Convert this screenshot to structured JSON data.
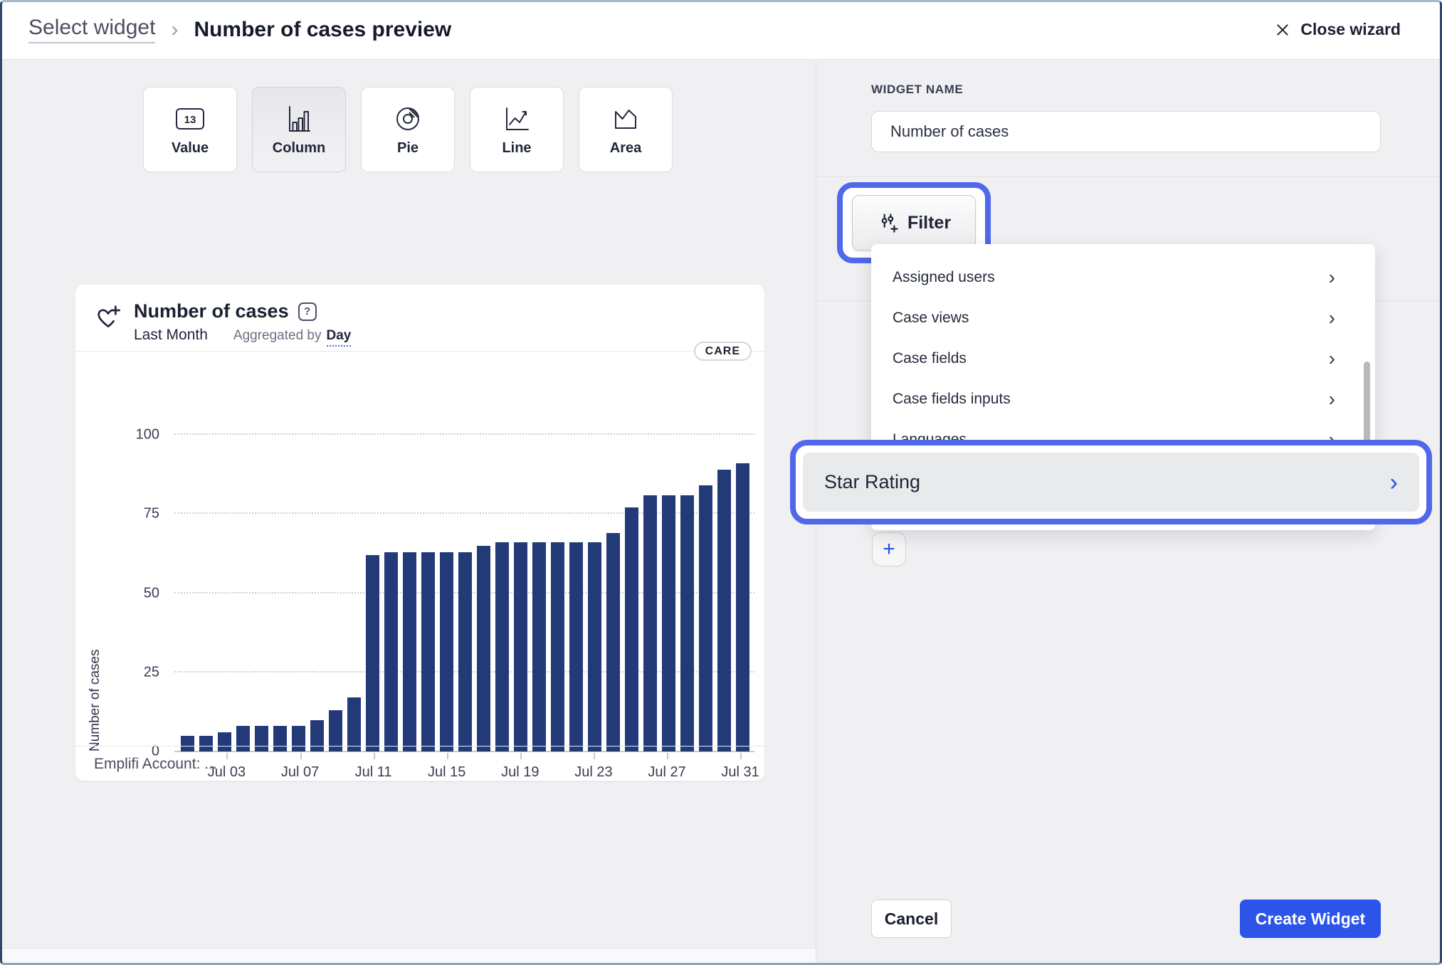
{
  "topbar": {
    "breadcrumb_back": "Select widget",
    "breadcrumb_separator": "›",
    "title": "Number of cases preview",
    "close_label": "Close wizard"
  },
  "widget_types": {
    "items": [
      {
        "label": "Value",
        "icon": "value-widget-icon",
        "selected": false
      },
      {
        "label": "Column",
        "icon": "column-widget-icon",
        "selected": true
      },
      {
        "label": "Pie",
        "icon": "pie-widget-icon",
        "selected": false
      },
      {
        "label": "Line",
        "icon": "line-widget-icon",
        "selected": false
      },
      {
        "label": "Area",
        "icon": "area-widget-icon",
        "selected": false
      }
    ]
  },
  "preview_card": {
    "title": "Number of cases",
    "help_glyph": "?",
    "period": "Last Month",
    "aggregated_prefix": "Aggregated by",
    "aggregated_value": "Day",
    "badge": "CARE",
    "footer": "Emplifi Account: ..."
  },
  "chart_data": {
    "type": "bar",
    "title": "Number of cases",
    "period": "Last Month",
    "aggregation": "Day",
    "ylabel": "Number of cases",
    "ylim": [
      0,
      100
    ],
    "yticks": [
      0,
      25,
      50,
      75,
      100
    ],
    "grid": "horizontal-dotted",
    "legend": "none",
    "bar_color": "#223a78",
    "x": [
      "Jul 01",
      "Jul 02",
      "Jul 03",
      "Jul 04",
      "Jul 05",
      "Jul 06",
      "Jul 07",
      "Jul 08",
      "Jul 09",
      "Jul 10",
      "Jul 11",
      "Jul 12",
      "Jul 13",
      "Jul 14",
      "Jul 15",
      "Jul 16",
      "Jul 17",
      "Jul 18",
      "Jul 19",
      "Jul 20",
      "Jul 21",
      "Jul 22",
      "Jul 23",
      "Jul 24",
      "Jul 25",
      "Jul 26",
      "Jul 27",
      "Jul 28",
      "Jul 29",
      "Jul 30",
      "Jul 31"
    ],
    "values": [
      5,
      5,
      6,
      8,
      8,
      8,
      8,
      10,
      13,
      17,
      62,
      63,
      63,
      63,
      63,
      63,
      65,
      66,
      66,
      66,
      66,
      66,
      66,
      69,
      77,
      81,
      81,
      81,
      84,
      89,
      91
    ],
    "xtick_labels": [
      "Jul 03",
      "Jul 07",
      "Jul 11",
      "Jul 15",
      "Jul 19",
      "Jul 23",
      "Jul 27",
      "Jul 31"
    ]
  },
  "panel": {
    "name_label": "WIDGET NAME",
    "name_value": "Number of cases",
    "filter_button": {
      "label": "Filter"
    },
    "dropdown": {
      "items": [
        {
          "label": "Assigned users"
        },
        {
          "label": "Case views"
        },
        {
          "label": "Case fields"
        },
        {
          "label": "Case fields inputs"
        },
        {
          "label": "Languages",
          "partially_hidden": true
        }
      ],
      "chevron": "›"
    },
    "highlighted_item": {
      "label": "Star Rating",
      "chevron": "›"
    },
    "add_button": "+",
    "cancel_label": "Cancel",
    "create_label": "Create Widget"
  },
  "colors": {
    "accent_blue": "#2d54e8",
    "annotation_ring_blue": "#5068ea",
    "bar_navy": "#223a78",
    "panel_background": "#f0f0f2"
  }
}
